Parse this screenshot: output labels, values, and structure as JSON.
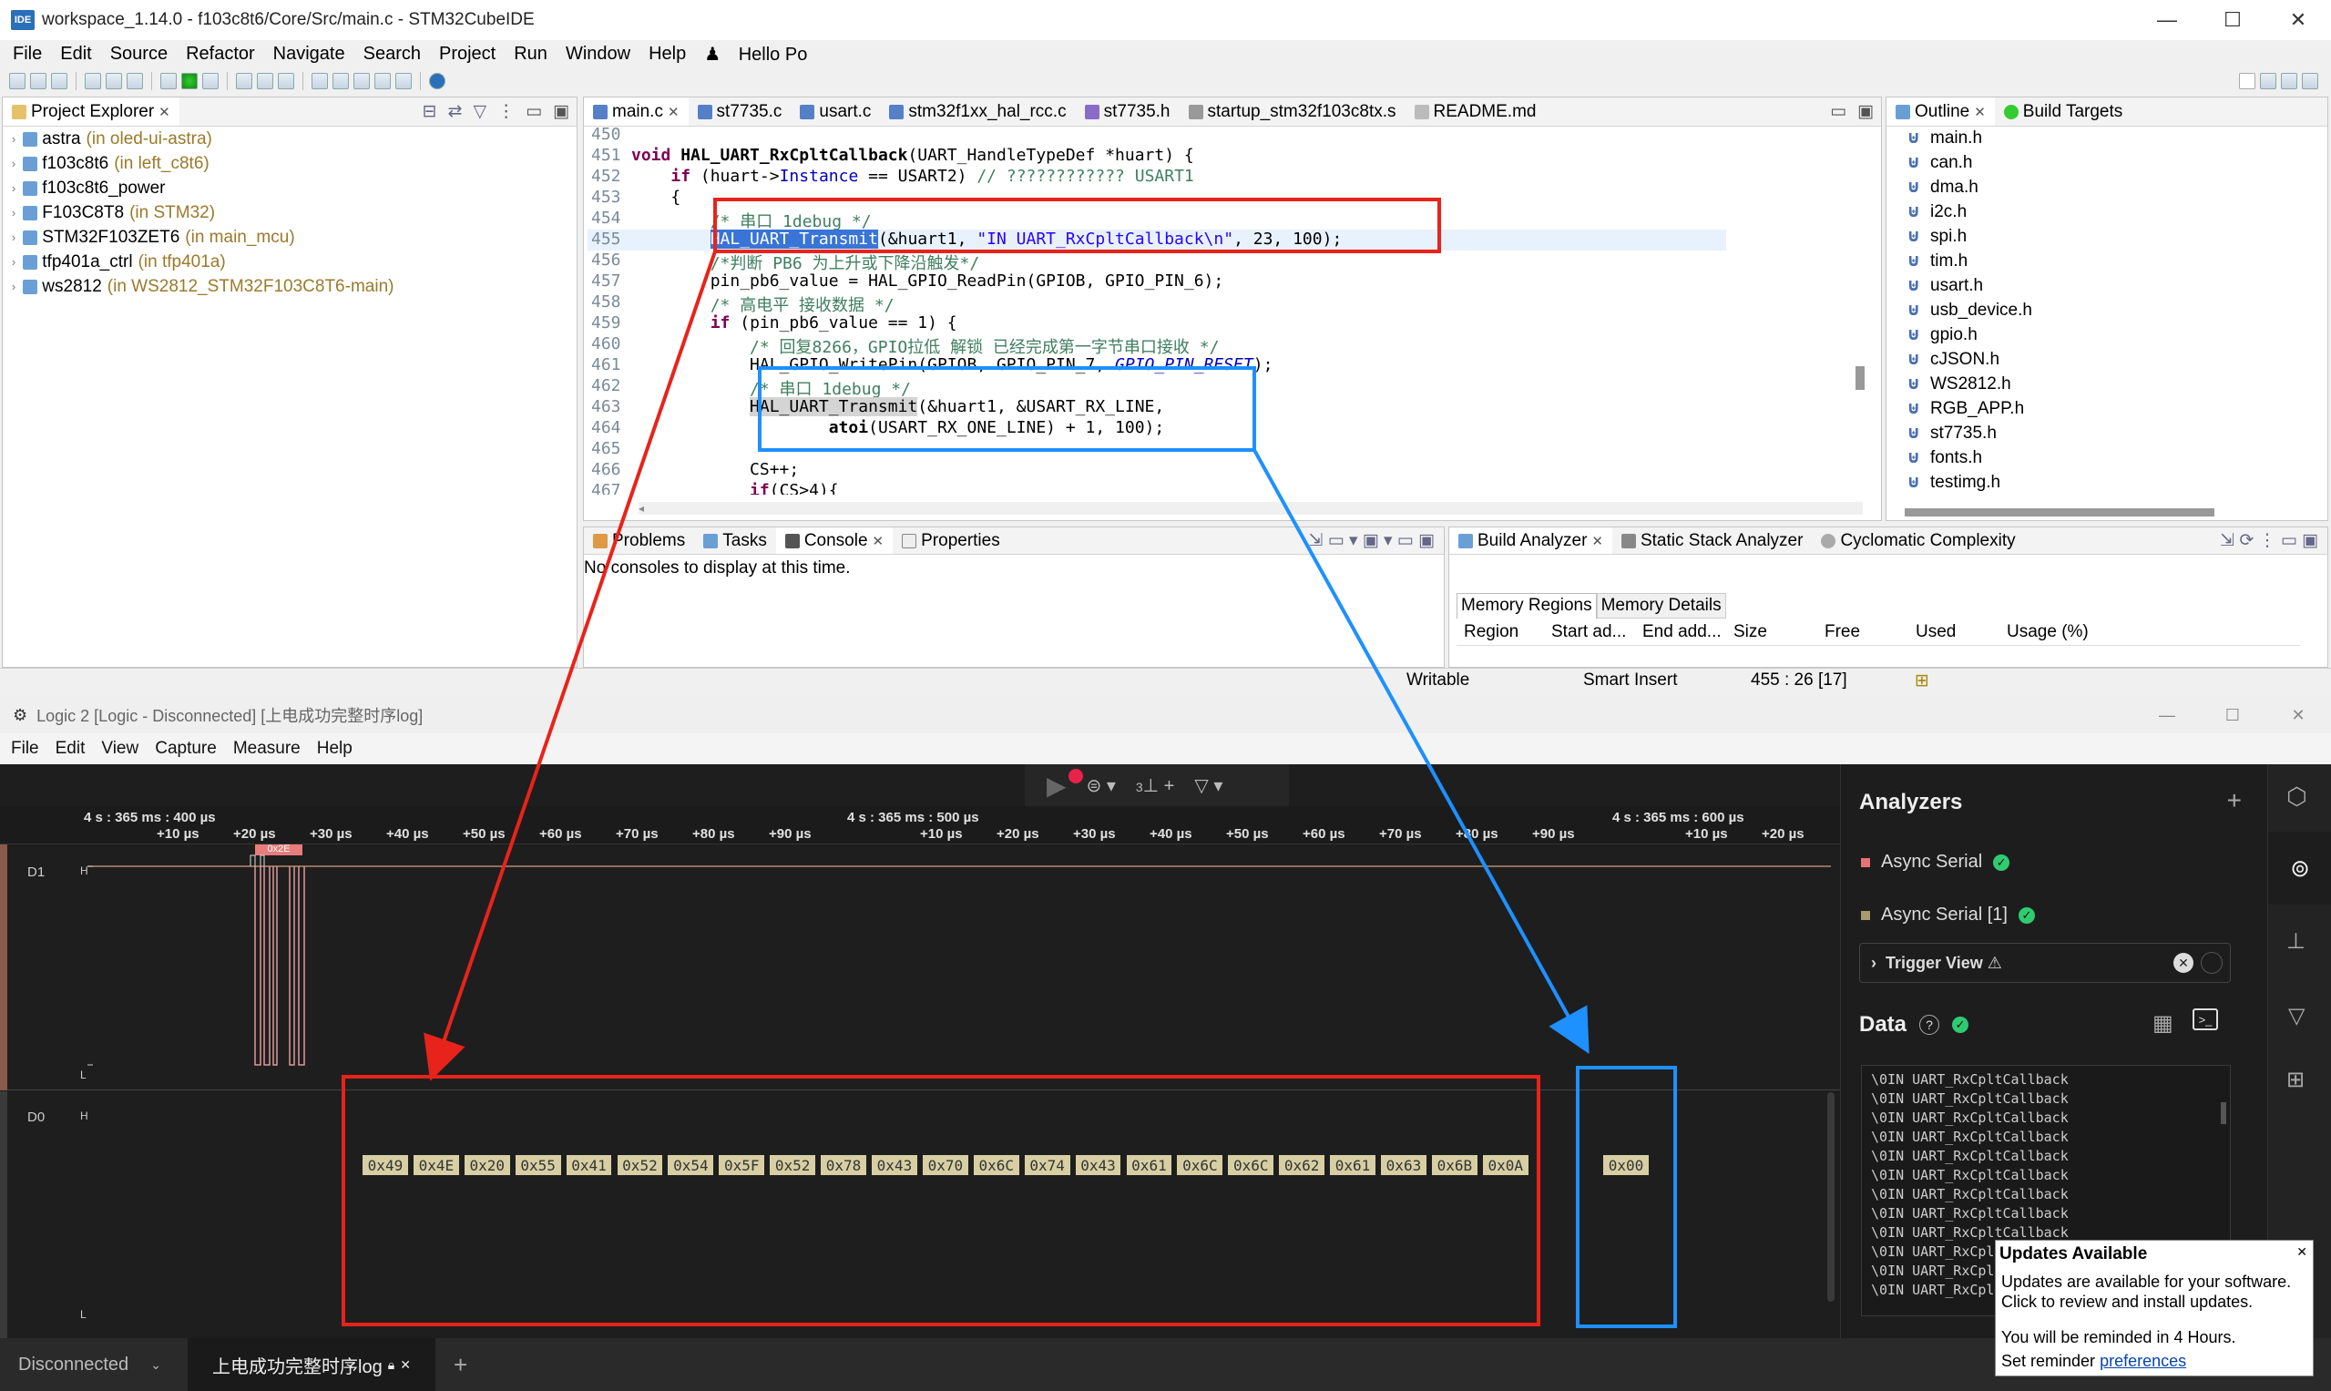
{
  "ide": {
    "title": "workspace_1.14.0 - f103c8t6/Core/Src/main.c - STM32CubeIDE",
    "logo": "IDE",
    "menu": [
      "File",
      "Edit",
      "Source",
      "Refactor",
      "Navigate",
      "Search",
      "Project",
      "Run",
      "Window",
      "Help"
    ],
    "menu_user": "Hello Po",
    "project_explorer": {
      "tab": "Project Explorer",
      "items": [
        {
          "name": "astra",
          "suffix": "(in oled-ui-astra)"
        },
        {
          "name": "f103c8t6",
          "suffix": "(in left_c8t6)"
        },
        {
          "name": "f103c8t6_power",
          "suffix": ""
        },
        {
          "name": "F103C8T8",
          "suffix": "(in STM32)"
        },
        {
          "name": "STM32F103ZET6",
          "suffix": "(in main_mcu)"
        },
        {
          "name": "tfp401a_ctrl",
          "suffix": "(in tfp401a)"
        },
        {
          "name": "ws2812",
          "suffix": "(in WS2812_STM32F103C8T6-main)"
        }
      ]
    },
    "editor_tabs": [
      "main.c",
      "st7735.c",
      "usart.c",
      "stm32f1xx_hal_rcc.c",
      "st7735.h",
      "startup_stm32f103c8tx.s",
      "README.md"
    ],
    "code_lines": [
      {
        "n": "450",
        "t": ""
      },
      {
        "n": "451",
        "t": "void HAL_UART_RxCpltCallback(UART_HandleTypeDef *huart) {"
      },
      {
        "n": "452",
        "t": "    if (huart->Instance == USART2) // ???????????? USART1"
      },
      {
        "n": "453",
        "t": "    {"
      },
      {
        "n": "454",
        "t": "        /* 串口 1debug */"
      },
      {
        "n": "455",
        "t": "        HAL_UART_Transmit(&huart1, \"IN UART_RxCpltCallback\\n\", 23, 100);"
      },
      {
        "n": "456",
        "t": "        /*判断 PB6 为上升或下降沿触发*/"
      },
      {
        "n": "457",
        "t": "        pin_pb6_value = HAL_GPIO_ReadPin(GPIOB, GPIO_PIN_6);"
      },
      {
        "n": "458",
        "t": "        /* 高电平 接收数据 */"
      },
      {
        "n": "459",
        "t": "        if (pin_pb6_value == 1) {"
      },
      {
        "n": "460",
        "t": "            /* 回复8266，GPIO拉低 解锁 已经完成第一字节串口接收 */"
      },
      {
        "n": "461",
        "t": "            HAL_GPIO_WritePin(GPIOB, GPIO_PIN_7, GPIO_PIN_RESET);"
      },
      {
        "n": "462",
        "t": "            /* 串口 1debug */"
      },
      {
        "n": "463",
        "t": "            HAL_UART_Transmit(&huart1, &USART_RX_LINE,"
      },
      {
        "n": "464",
        "t": "                    atoi(USART_RX_ONE_LINE) + 1, 100);"
      },
      {
        "n": "465",
        "t": ""
      },
      {
        "n": "466",
        "t": "            CS++;"
      },
      {
        "n": "467",
        "t": "            if(CS>4){"
      }
    ],
    "outline": {
      "tabs": [
        "Outline",
        "Build Targets"
      ],
      "items": [
        "main.h",
        "can.h",
        "dma.h",
        "i2c.h",
        "spi.h",
        "tim.h",
        "usart.h",
        "usb_device.h",
        "gpio.h",
        "cJSON.h",
        "WS2812.h",
        "RGB_APP.h",
        "st7735.h",
        "fonts.h",
        "testimg.h"
      ]
    },
    "console": {
      "tabs": [
        "Problems",
        "Tasks",
        "Console",
        "Properties"
      ],
      "message": "No consoles to display at this time."
    },
    "build_analyzer": {
      "tabs": [
        "Build Analyzer",
        "Static Stack Analyzer",
        "Cyclomatic Complexity"
      ],
      "subtabs": [
        "Memory Regions",
        "Memory Details"
      ],
      "columns": [
        "Region",
        "Start ad...",
        "End add...",
        "Size",
        "Free",
        "Used",
        "Usage (%)"
      ]
    },
    "status": {
      "writable": "Writable",
      "insert": "Smart Insert",
      "position": "455 : 26 [17]"
    }
  },
  "logic": {
    "title": "Logic 2 [Logic - Disconnected] [上电成功完整时序log]",
    "menu": [
      "File",
      "Edit",
      "View",
      "Capture",
      "Measure",
      "Help"
    ],
    "toolbar": {
      "trigger_count": "3"
    },
    "ruler": {
      "major": [
        "4 s : 365 ms : 400 µs",
        "4 s : 365 ms : 500 µs",
        "4 s : 365 ms : 600 µs"
      ],
      "minor": [
        "+10 µs",
        "+20 µs",
        "+30 µs",
        "+40 µs",
        "+50 µs",
        "+60 µs",
        "+70 µs",
        "+80 µs",
        "+90 µs"
      ]
    },
    "channels": [
      {
        "name": "D1",
        "hi": "H",
        "lo": "L",
        "tag": "0x2E"
      },
      {
        "name": "D0",
        "hi": "H",
        "lo": "L"
      }
    ],
    "d0_bytes": [
      "0x49",
      "0x4E",
      "0x20",
      "0x55",
      "0x41",
      "0x52",
      "0x54",
      "0x5F",
      "0x52",
      "0x78",
      "0x43",
      "0x70",
      "0x6C",
      "0x74",
      "0x43",
      "0x61",
      "0x6C",
      "0x6C",
      "0x62",
      "0x61",
      "0x63",
      "0x6B",
      "0x0A"
    ],
    "d0_extra": "0x00",
    "analyzers": {
      "title": "Analyzers",
      "items": [
        {
          "name": "Async Serial",
          "color": "#e57373"
        },
        {
          "name": "Async Serial [1]",
          "color": "#a89a6e"
        }
      ],
      "trigger_view": "Trigger View ⚠"
    },
    "data": {
      "title": "Data",
      "rows": [
        "\\0IN UART_RxCpltCallback",
        "\\0IN UART_RxCpltCallback",
        "\\0IN UART_RxCpltCallback",
        "\\0IN UART_RxCpltCallback",
        "\\0IN UART_RxCpltCallback",
        "\\0IN UART_RxCpltCallback",
        "\\0IN UART_RxCpltCallback",
        "\\0IN UART_RxCpltCallback",
        "\\0IN UART_RxCpltCallback",
        "\\0IN UART_RxCpl",
        "\\0IN UART_RxCpl",
        "\\0IN UART_RxCpl"
      ]
    },
    "status": {
      "connection": "Disconnected",
      "tab": "上电成功完整时序log"
    },
    "popup": {
      "title": "Updates Available",
      "line1": "Updates are available for your software. Click to review and install updates.",
      "line2": "You will be reminded in 4 Hours.",
      "line3": "Set reminder",
      "link": "preferences"
    }
  },
  "colors": {
    "red_box": "#e8231b",
    "blue_box": "#1e90ff",
    "accent_green": "#2ecc71"
  }
}
